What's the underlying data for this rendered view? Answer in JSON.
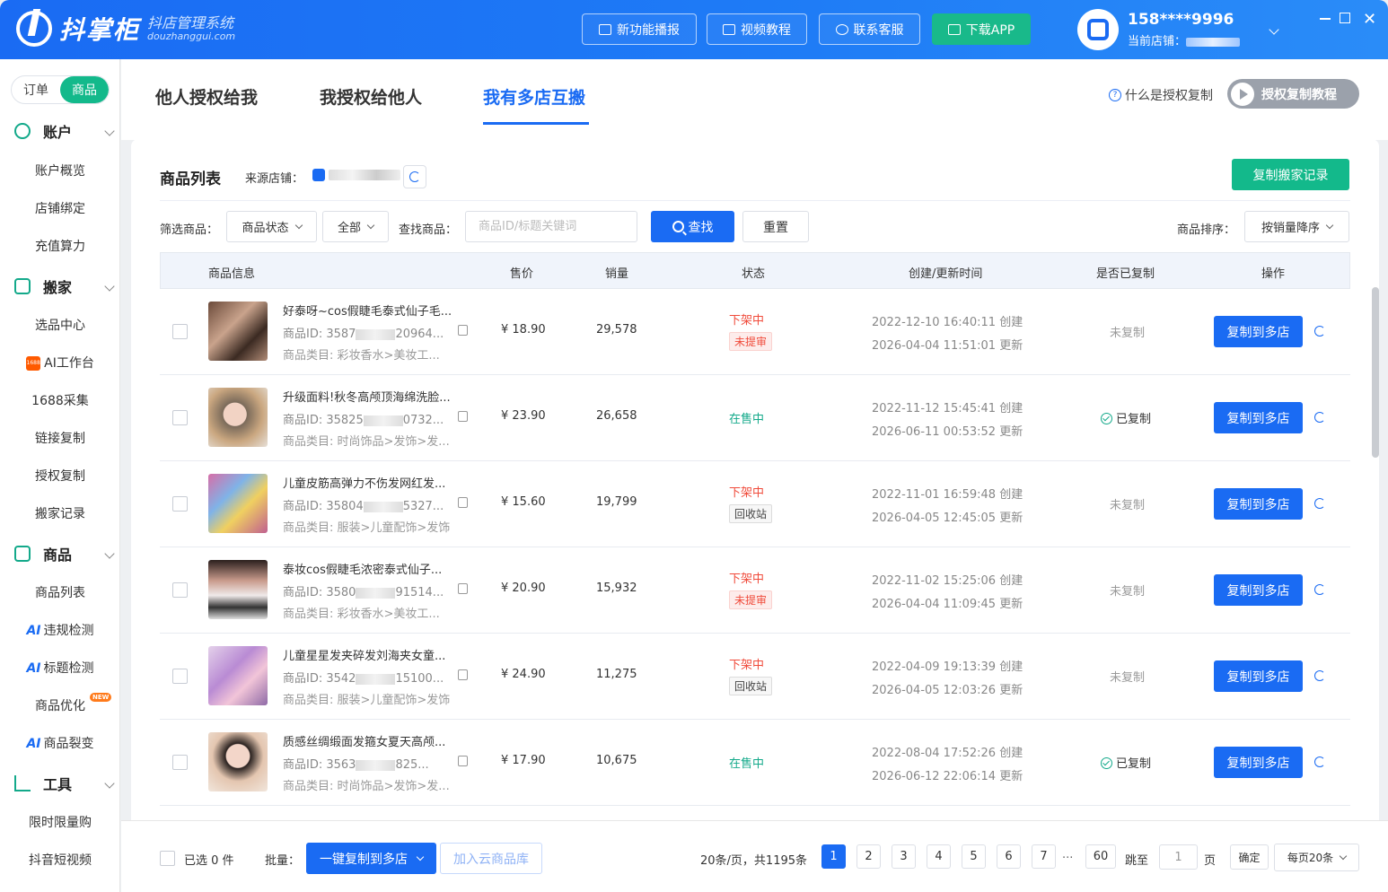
{
  "titlebar": {
    "logo_name": "抖掌柜",
    "logo_sub1": "抖店管理系统",
    "logo_sub2": "douzhanggui.com",
    "buttons": [
      "新功能播报",
      "视频教程",
      "联系客服",
      "下载APP"
    ],
    "user_phone": "158****9996",
    "current_store_label": "当前店铺："
  },
  "sidebar": {
    "toggle": [
      "订单",
      "商品"
    ],
    "groups": {
      "account": "账户",
      "move": "搬家",
      "goods": "商品",
      "tools": "工具"
    },
    "account_items": [
      "账户概览",
      "店铺绑定",
      "充值算力"
    ],
    "move_items": [
      "选品中心",
      "AI工作台",
      "1688采集",
      "链接复制",
      "授权复制",
      "搬家记录"
    ],
    "goods_items": [
      "商品列表",
      "违规检测",
      "标题检测",
      "商品优化",
      "商品裂变"
    ],
    "tools_items": [
      "限时限量购",
      "抖音短视频"
    ],
    "ai_prefix": "AI",
    "new_badge": "NEW"
  },
  "tabs": {
    "items": [
      "他人授权给我",
      "我授权给他人",
      "我有多店互搬"
    ],
    "help": "什么是授权复制",
    "tutorial": "授权复制教程"
  },
  "card": {
    "title": "商品列表",
    "source_label": "来源店铺：",
    "record_btn": "复制搬家记录",
    "filter_label": "筛选商品：",
    "status_select": "商品状态",
    "all_select": "全部",
    "search_label": "查找商品：",
    "search_placeholder": "商品ID/标题关键词",
    "search_btn": "查找",
    "reset_btn": "重置",
    "sort_label": "商品排序：",
    "sort_select": "按销量降序"
  },
  "table": {
    "headers": [
      "商品信息",
      "售价",
      "销量",
      "状态",
      "创建/更新时间",
      "是否已复制",
      "操作"
    ],
    "id_prefix": "商品ID: ",
    "cat_prefix": "商品类目: ",
    "action": "复制到多店",
    "rows": [
      {
        "title": "好泰呀~cos假睫毛泰式仙子毛...",
        "id_a": "3587",
        "id_b": "20964...",
        "category": "彩妆香水>美妆工...",
        "price": "¥ 18.90",
        "sales": "29,578",
        "status": "下架中",
        "tag": "未提审",
        "created": "2022-12-10 16:40:11 创建",
        "updated": "2026-04-04 11:51:01 更新",
        "copied": "未复制"
      },
      {
        "title": "升级面料!秋冬高颅顶海绵洗脸...",
        "id_a": "35825",
        "id_b": "0732...",
        "category": "时尚饰品>发饰>发...",
        "price": "¥ 23.90",
        "sales": "26,658",
        "status": "在售中",
        "tag": "",
        "created": "2022-11-12 15:45:41 创建",
        "updated": "2026-06-11 00:53:52 更新",
        "copied": "已复制"
      },
      {
        "title": "儿童皮筋高弹力不伤发网红发...",
        "id_a": "35804",
        "id_b": "5327...",
        "category": "服装>儿童配饰>发饰",
        "price": "¥ 15.60",
        "sales": "19,799",
        "status": "下架中",
        "tag": "回收站",
        "created": "2022-11-01 16:59:48 创建",
        "updated": "2026-04-05 12:45:05 更新",
        "copied": "未复制"
      },
      {
        "title": "泰妆cos假睫毛浓密泰式仙子...",
        "id_a": "3580",
        "id_b": "91514...",
        "category": "彩妆香水>美妆工...",
        "price": "¥ 20.90",
        "sales": "15,932",
        "status": "下架中",
        "tag": "未提审",
        "created": "2022-11-02 15:25:06 创建",
        "updated": "2026-04-04 11:09:45 更新",
        "copied": "未复制"
      },
      {
        "title": "儿童星星发夹碎发刘海夹女童...",
        "id_a": "3542",
        "id_b": "15100...",
        "category": "服装>儿童配饰>发饰",
        "price": "¥ 24.90",
        "sales": "11,275",
        "status": "下架中",
        "tag": "回收站",
        "created": "2022-04-09 19:13:39 创建",
        "updated": "2026-04-05 12:03:26 更新",
        "copied": "未复制"
      },
      {
        "title": "质感丝绸缎面发箍女夏天高颅...",
        "id_a": "3563",
        "id_b": "825...",
        "category": "时尚饰品>发饰>发...",
        "price": "¥ 17.90",
        "sales": "10,675",
        "status": "在售中",
        "tag": "",
        "created": "2022-08-04 17:52:26 创建",
        "updated": "2026-06-12 22:06:14 更新",
        "copied": "已复制"
      }
    ]
  },
  "footer": {
    "selected": "已选 0 件",
    "batch_label": "批量：",
    "batch_btn": "一键复制到多店",
    "cloud_btn": "加入云商品库",
    "page_info": "20条/页，共1195条",
    "pages": [
      "1",
      "2",
      "3",
      "4",
      "5",
      "6",
      "7"
    ],
    "ellipsis": "...",
    "last_page": "60",
    "jump_label": "跳至",
    "jump_value": "1",
    "page_unit": "页",
    "confirm": "确定",
    "per_page": "每页20条"
  },
  "colors": {
    "brand_blue": "#1a6bf3",
    "green": "#13b98b",
    "red": "#f04b3b"
  }
}
